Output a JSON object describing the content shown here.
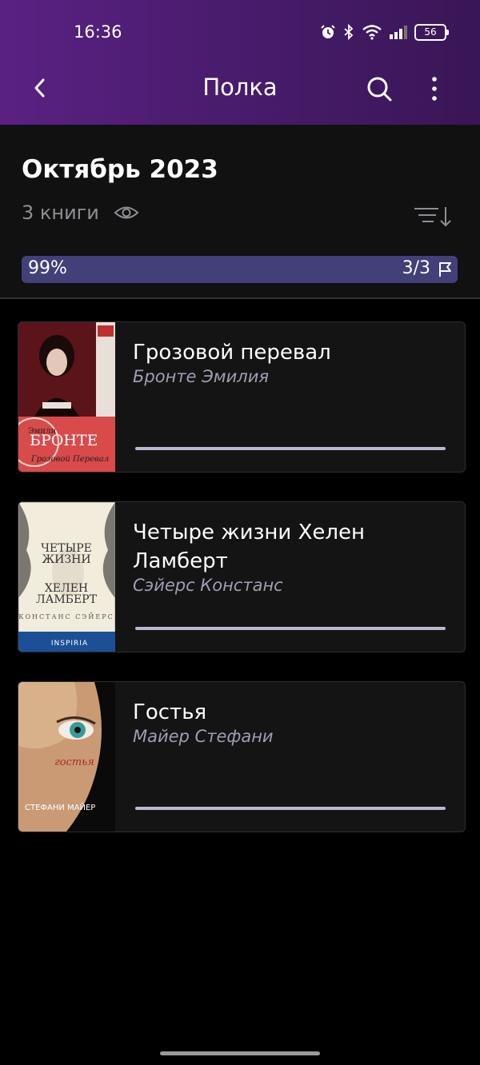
{
  "status_bar": {
    "time": "16:36",
    "battery": "56",
    "icons": [
      "alarm-icon",
      "bluetooth-icon",
      "wifi-icon",
      "signal-icon",
      "battery-icon"
    ]
  },
  "nav": {
    "title": "Полка",
    "icons": [
      "back-arrow-icon",
      "search-icon",
      "more-vertical-icon"
    ]
  },
  "shelf": {
    "title": "Октябрь 2023",
    "count": "3 книги",
    "progress_percent": "99%",
    "progress_count": "3/3",
    "progress_value": 0.99
  },
  "books": [
    {
      "title": "Грозовой перевал",
      "author": "Бронте Эмилия",
      "cover_author": "Эмили",
      "cover_surname": "БРОНТЕ",
      "cover_title": "Грозовой Перевал"
    },
    {
      "title": "Четыре жизни Хелен Ламберт",
      "author": "Сэйерс Констанс",
      "cover_title_1": "ЧЕТЫРЕ",
      "cover_title_2": "ЖИЗНИ",
      "cover_title_3": "ХЕЛЕН",
      "cover_title_4": "ЛАМБЕРТ",
      "cover_author": "КОНСТАНС СЭЙЕРС",
      "cover_publisher": "INSPIRIA"
    },
    {
      "title": "Гостья",
      "author": "Майер Стефани",
      "cover_title": "гостья",
      "cover_author": "СТЕФАНИ МАЙЕР"
    }
  ],
  "colors": {
    "header_gradient_start": "#5a2183",
    "header_gradient_end": "#391657",
    "progress_fill": "#423f79",
    "author_text": "#9e9eb4"
  }
}
